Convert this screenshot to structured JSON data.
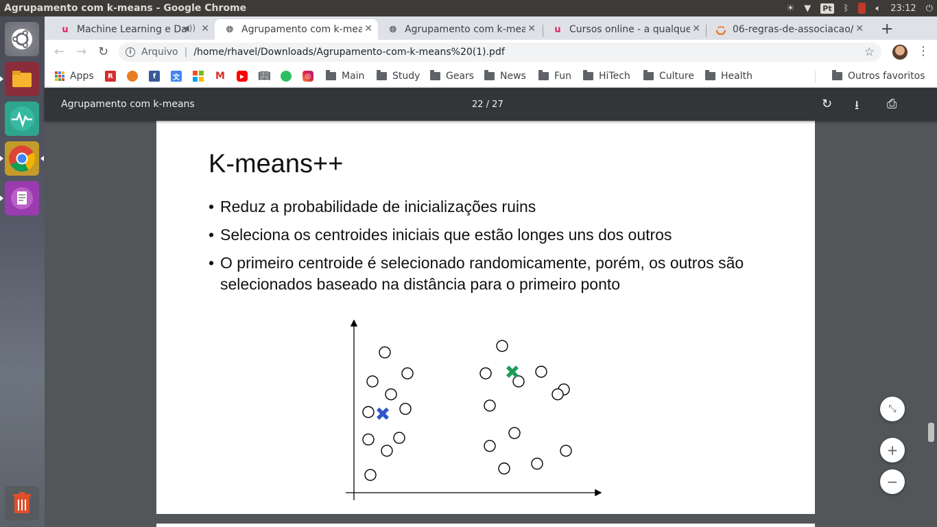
{
  "window_title": "Agrupamento com k-means - Google Chrome",
  "system_tray": {
    "pt_label": "Pt",
    "clock": "23:12"
  },
  "launcher": [
    {
      "name": "ubuntu-dash"
    },
    {
      "name": "files"
    },
    {
      "name": "system-monitor"
    },
    {
      "name": "chrome"
    },
    {
      "name": "text-editor"
    },
    {
      "name": "trash"
    }
  ],
  "tabs": [
    {
      "title": "Machine Learning e Da",
      "favicon": "udemy-icon",
      "active": false,
      "audio": true
    },
    {
      "title": "Agrupamento com k-mea",
      "favicon": "globe-icon",
      "active": true
    },
    {
      "title": "Agrupamento com k-mea",
      "favicon": "globe-icon",
      "active": false
    },
    {
      "title": "Cursos online - a qualquer",
      "favicon": "udemy-icon",
      "active": false
    },
    {
      "title": "06-regras-de-associacao/",
      "favicon": "jupyter-icon",
      "active": false
    }
  ],
  "omnibox": {
    "security_label": "Arquivo",
    "url": "/home/rhavel/Downloads/Agrupamento-com-k-means%20(1).pdf"
  },
  "bookmarks": {
    "apps": "Apps",
    "folders": [
      "Main",
      "Study",
      "Gears",
      "News",
      "Fun",
      "HiTech",
      "Culture",
      "Health"
    ],
    "other": "Outros favoritos"
  },
  "pdf": {
    "doc_title": "Agrupamento com k-means",
    "page_indicator": "22 / 27"
  },
  "slide": {
    "title": "K-means++",
    "bullets": [
      "Reduz a probabilidade de inicializações ruins",
      "Seleciona os centroides iniciais que estão longes uns dos outros",
      "O primeiro centroide é selecionado randomicamente, porém, os outros são selecionados baseado na distância para o primeiro ponto"
    ]
  },
  "chart_data": {
    "type": "scatter",
    "title": "",
    "xlabel": "",
    "ylabel": "",
    "xlim": [
      0,
      100
    ],
    "ylim": [
      0,
      100
    ],
    "series": [
      {
        "color": "#000000",
        "marker": "open-circle",
        "x": [
          15,
          26,
          9,
          18,
          7,
          25,
          7,
          22,
          16,
          8,
          72,
          91,
          64,
          80,
          102,
          99,
          66,
          78,
          66,
          103,
          89,
          73
        ],
        "y": [
          87,
          74,
          69,
          61,
          50,
          52,
          33,
          34,
          26,
          11,
          91,
          75,
          74,
          69,
          64,
          61,
          54,
          37,
          29,
          26,
          18,
          15
        ]
      },
      {
        "color": "#2f55c8",
        "marker": "x",
        "x": [
          14
        ],
        "y": [
          49
        ]
      },
      {
        "color": "#1d9d57",
        "marker": "x",
        "x": [
          77
        ],
        "y": [
          75
        ]
      }
    ]
  }
}
